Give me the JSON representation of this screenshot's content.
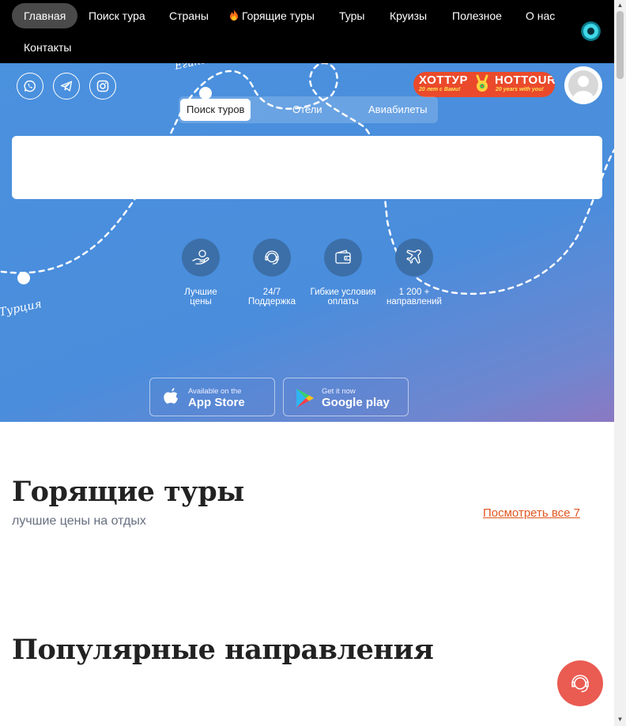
{
  "nav": {
    "items": [
      {
        "label": "Главная",
        "active": true
      },
      {
        "label": "Поиск тура"
      },
      {
        "label": "Страны"
      },
      {
        "label": "Горящие туры",
        "icon": "flame-icon"
      },
      {
        "label": "Туры"
      },
      {
        "label": "Круизы"
      },
      {
        "label": "Полезное"
      },
      {
        "label": "О нас"
      },
      {
        "label": "Контакты"
      }
    ]
  },
  "hero": {
    "social": [
      "whatsapp-icon",
      "telegram-icon",
      "instagram-icon"
    ],
    "logo": {
      "left": "ХОТТУР",
      "right": "HOTTOUR",
      "sub_left": "20 лет с Вами!",
      "sub_right": "20 years with you!"
    },
    "map_labels": [
      "Египет",
      "Турция"
    ],
    "tabs": [
      "Поиск туров",
      "Отели",
      "Авиабилеты"
    ],
    "active_tab": "Поиск туров",
    "features": [
      {
        "label": "Лучшие цены",
        "icon": "hand-coin-icon"
      },
      {
        "label": "24/7 Поддержка",
        "icon": "support-headset-icon"
      },
      {
        "label": "Гибкие условия оплаты",
        "icon": "wallet-icon"
      },
      {
        "label": "1 200 + направлений",
        "icon": "plane-icon"
      }
    ],
    "stores": {
      "apple": {
        "small": "Available on the",
        "big": "App Store"
      },
      "google": {
        "small": "Get it now",
        "big": "Google play"
      }
    }
  },
  "hot_tours": {
    "title": "Горящие туры",
    "subtitle": "лучшие цены на отдых",
    "see_all": "Посмотреть все 7"
  },
  "popular": {
    "title": "Популярные направления"
  },
  "colors": {
    "nav_bg": "#000000",
    "accent": "#e0561f",
    "hero_blue": "#4a91de",
    "support_button": "#ea5b52"
  }
}
